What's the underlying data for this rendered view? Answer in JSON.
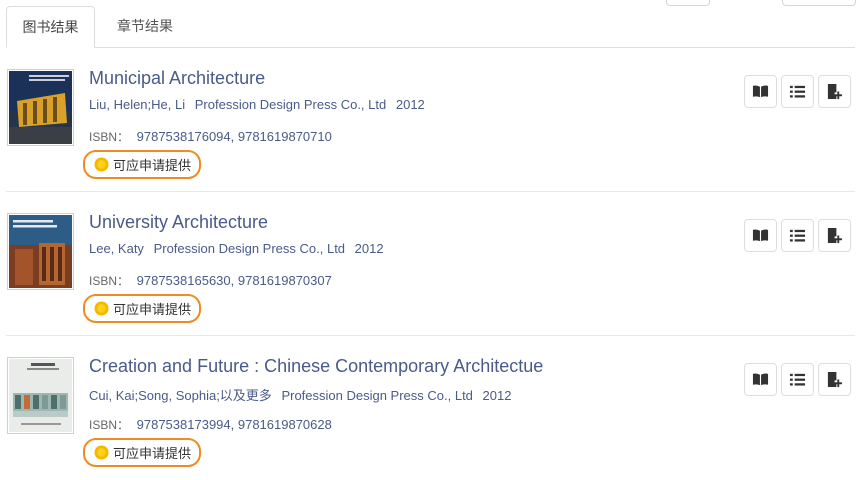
{
  "tabs": [
    {
      "label": "图书结果",
      "active": true
    },
    {
      "label": "章节结果",
      "active": false
    }
  ],
  "results": [
    {
      "title": "Municipal Architecture",
      "authors": "Liu, Helen;He, Li",
      "publisher": "Profession Design Press Co., Ltd",
      "year": "2012",
      "isbn_label": "ISBN：",
      "isbn": "9787538176094, 9781619870710",
      "availability": "可应申请提供",
      "cover_text": "MUNICIPAL ARCHITECTURE"
    },
    {
      "title": "University Architecture",
      "authors": "Lee, Katy",
      "publisher": "Profession Design Press Co., Ltd",
      "year": "2012",
      "isbn_label": "ISBN：",
      "isbn": "9787538165630, 9781619870307",
      "availability": "可应申请提供",
      "cover_text": "UNIVERSITY ARCHITECTURE"
    },
    {
      "title": "Creation and Future : Chinese Contemporary Architectue",
      "authors": "Cui, Kai;Song, Sophia;以及更多",
      "publisher": "Profession Design Press Co., Ltd",
      "year": "2012",
      "isbn_label": "ISBN：",
      "isbn": "9787538173994, 9781619870628",
      "availability": "可应申请提供",
      "cover_text": "创造与未来"
    }
  ],
  "actions": {
    "icons": [
      "book-open-icon",
      "list-icon",
      "add-to-shelf-icon"
    ]
  },
  "colors": {
    "title": "#4a5a8a",
    "highlight_border": "#f08a24",
    "sun": "#f5b800"
  }
}
